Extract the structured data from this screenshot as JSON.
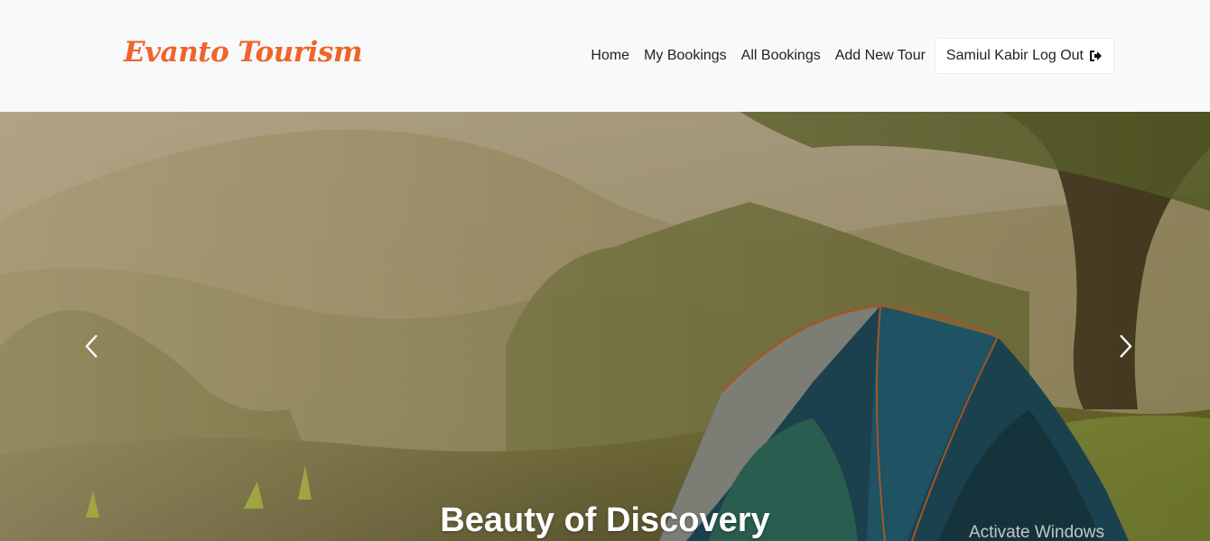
{
  "navbar": {
    "brand": "Evanto Tourism",
    "links": [
      {
        "label": "Home"
      },
      {
        "label": "My Bookings"
      },
      {
        "label": "All Bookings"
      },
      {
        "label": "Add New Tour"
      }
    ],
    "logout_label": "Samiul Kabir Log Out",
    "logout_icon": "sign-out-icon"
  },
  "hero": {
    "caption": "Beauty of Discovery",
    "prev_icon": "chevron-left-icon",
    "next_icon": "chevron-right-icon",
    "image": "tent-in-forest-photo"
  },
  "overlay": {
    "watermark": "Activate Windows"
  },
  "colors": {
    "brand": "#f0642a",
    "header_bg": "#f8f9fb",
    "text": "#222222"
  }
}
